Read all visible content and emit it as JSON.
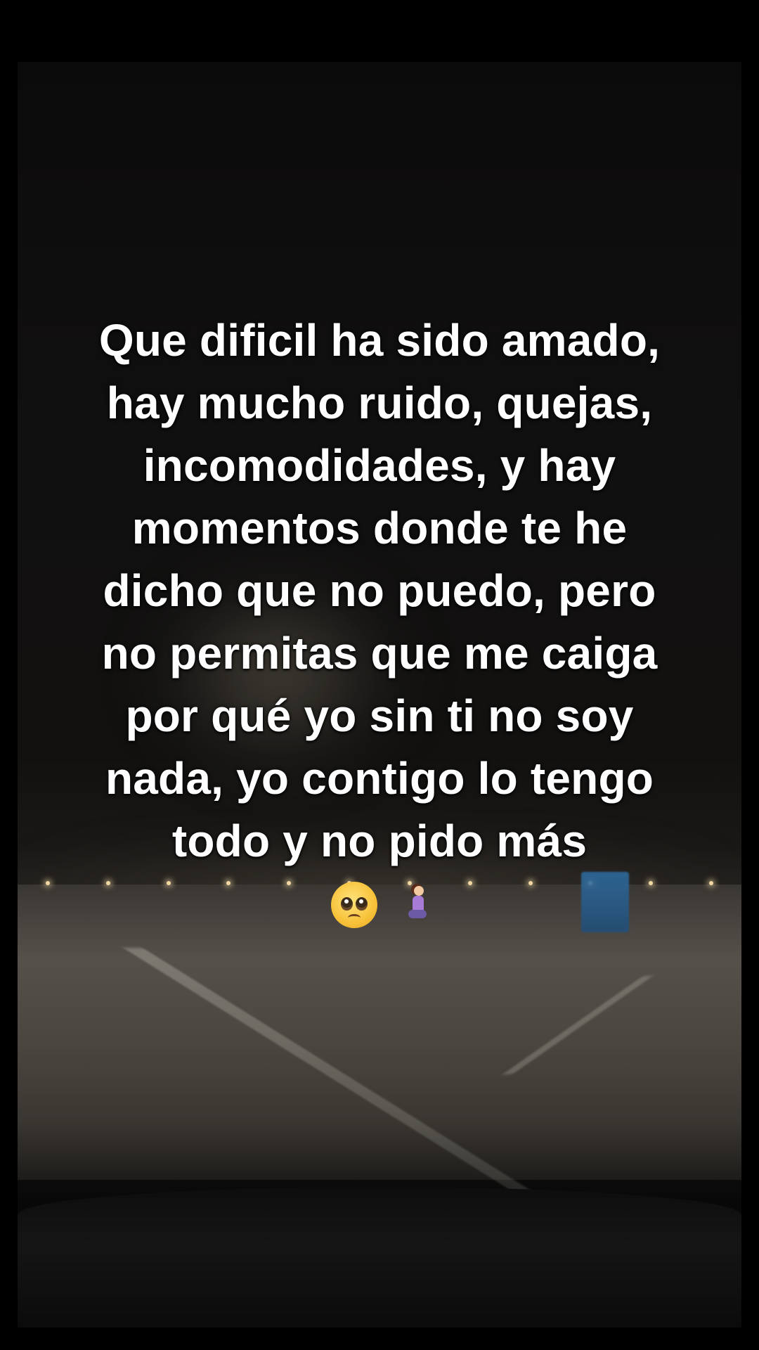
{
  "caption": {
    "text": "Que dificil ha sido amado,\nhay mucho ruido, quejas,\nincomodidades, y hay\nmomentos donde te he\ndicho que no puedo, pero\nno permitas que me caiga\npor qué yo sin ti no soy\nnada, yo contigo lo tengo\ntodo y no pido más"
  },
  "emojis": {
    "items": [
      "pleading-face-emoji",
      "kneeling-woman-emoji"
    ]
  },
  "colors": {
    "caption_text": "#ffffff",
    "frame_background": "#000000"
  }
}
